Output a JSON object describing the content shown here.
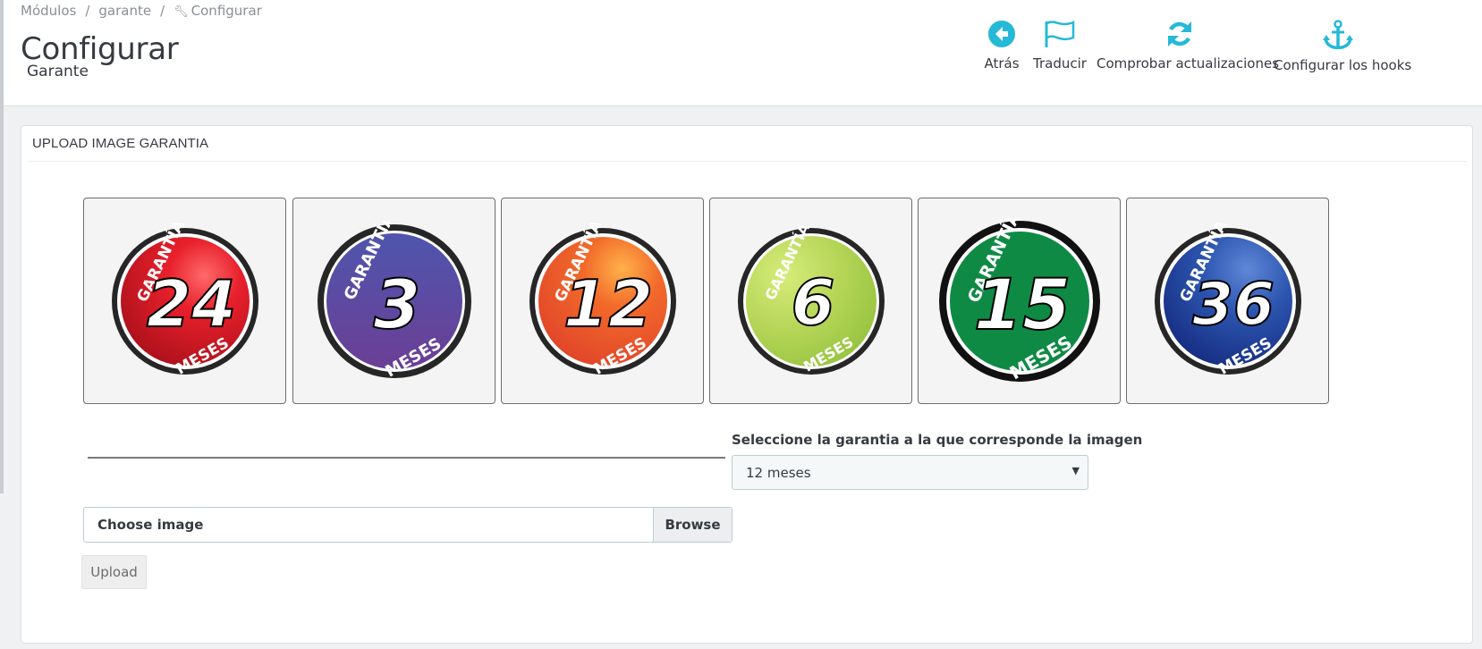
{
  "breadcrumb": {
    "item1": "Módulos",
    "sep": "/",
    "item2": "garante",
    "item3": "Configurar",
    "item3_icon": "wrench-icon"
  },
  "header": {
    "title": "Configurar",
    "subtitle": "Garante"
  },
  "toolbar": {
    "back_label": "Atrás",
    "translate_label": "Traducir",
    "check_updates_label": "Comprobar actualizaciones",
    "hooks_label": "Configurar los hooks",
    "accent_color": "#25b9d7"
  },
  "panel": {
    "heading": "UPLOAD IMAGE GARANTIA",
    "badges": [
      {
        "top_text": "GARANTÍA",
        "number": "24",
        "bottom_text": "MESES",
        "color_light": "#e8202c",
        "color_dark": "#a8101a"
      },
      {
        "top_text": "GARANTÍA",
        "number": "3",
        "bottom_text": "MESES",
        "color_light": "#5a55ad",
        "color_dark": "#6b3f95"
      },
      {
        "top_text": "GARANTÍA",
        "number": "12",
        "bottom_text": "MESES",
        "color_light": "#f26a2a",
        "color_dark": "#e0422a"
      },
      {
        "top_text": "GARANTÍA",
        "number": "6",
        "bottom_text": "MESES",
        "color_light": "#b4d456",
        "color_dark": "#8fbf3a"
      },
      {
        "top_text": "GARANTÍA",
        "number": "15",
        "bottom_text": "MESES",
        "color_light": "#0f8a45",
        "color_dark": "#06703a"
      },
      {
        "top_text": "GARANTÍA",
        "number": "36",
        "bottom_text": "MESES",
        "color_light": "#2d56b0",
        "color_dark": "#142a7e"
      }
    ],
    "select_label": "Seleccione la garantia a la que corresponde la imagen",
    "select_value": "12 meses",
    "select_caret": "▼",
    "file_placeholder": "Choose image",
    "browse_label": "Browse",
    "upload_label": "Upload"
  }
}
